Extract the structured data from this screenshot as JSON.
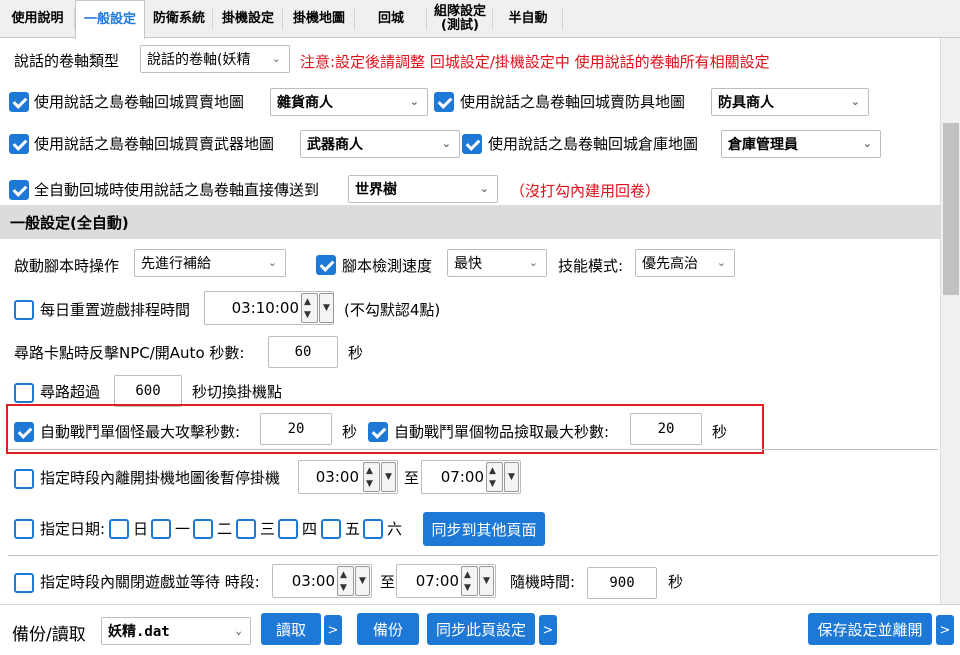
{
  "tabs": [
    {
      "label": "使用說明"
    },
    {
      "label": "一般設定"
    },
    {
      "label": "防衛系統"
    },
    {
      "label": "掛機設定"
    },
    {
      "label": "掛機地圖"
    },
    {
      "label": "回城"
    },
    {
      "label": "組隊設定\n(測試)"
    },
    {
      "label": "半自動"
    }
  ],
  "scroll_type": {
    "label": "說話的卷軸類型",
    "value": "說話的卷軸(妖精",
    "note": "注意:設定後請調整 回城設定/掛機設定中 使用說話的卷軸所有相關設定"
  },
  "return_rows": [
    {
      "label": "使用說話之島卷軸回城買賣地圖",
      "value": "雜貨商人",
      "checked": true
    },
    {
      "label": "使用說話之島卷軸回城賣防具地圖",
      "value": "防具商人",
      "checked": true
    },
    {
      "label": "使用說話之島卷軸回城買賣武器地圖",
      "value": "武器商人",
      "checked": true
    },
    {
      "label": "使用說話之島卷軸回城倉庫地圖",
      "value": "倉庫管理員",
      "checked": true
    },
    {
      "label": "全自動回城時使用說話之島卷軸直接傳送到",
      "value": "世界樹",
      "checked": true,
      "note": "（沒打勾內建用回卷）"
    }
  ],
  "section_title": "一般設定(全自動)",
  "startup": {
    "label": "啟動腳本時操作",
    "value": "先進行補給",
    "speed_label": "腳本檢測速度",
    "speed_checked": true,
    "speed_value": "最快",
    "skill_label": "技能模式:",
    "skill_value": "優先高治"
  },
  "daily_reset": {
    "label": "每日重置遊戲排程時間",
    "checked": false,
    "time": "03:10:00",
    "note": "(不勾默認4點)"
  },
  "pathfind_stuck": {
    "label": "尋路卡點時反擊NPC/開Auto 秒數:",
    "value": "60",
    "unit": "秒"
  },
  "pathfind_over": {
    "label": "尋路超過",
    "checked": false,
    "value": "600",
    "suffix": "秒切換掛機點"
  },
  "battle": {
    "monster_label": "自動戰鬥單個怪最大攻擊秒數:",
    "monster_checked": true,
    "monster_value": "20",
    "monster_unit": "秒",
    "item_label": "自動戰鬥單個物品撿取最大秒數:",
    "item_checked": true,
    "item_value": "20",
    "item_unit": "秒"
  },
  "pause_period": {
    "label": "指定時段內離開掛機地圖後暫停掛機",
    "checked": false,
    "from": "03:00",
    "to_label": "至",
    "to": "07:00"
  },
  "weekdays": {
    "label": "指定日期:",
    "days": [
      "日",
      "一",
      "二",
      "三",
      "四",
      "五",
      "六"
    ],
    "sync_label": "同步到其他頁面"
  },
  "close_period": {
    "label": "指定時段內關閉遊戲並等待 時段:",
    "checked": false,
    "from": "03:00",
    "to_label": "至",
    "to": "07:00",
    "random_label": "隨機時間:",
    "random_value": "900",
    "unit": "秒"
  },
  "bottom": {
    "label": "備份/讀取",
    "file": "妖精.dat",
    "read": "讀取",
    "more": ">",
    "backup": "備份",
    "sync_page": "同步此頁設定",
    "save_exit": "保存設定並離開"
  },
  "colors": {
    "accent": "#1e78d6",
    "warning": "#e0101a",
    "highlight": "#e02020",
    "section": "#dcdcdc"
  }
}
